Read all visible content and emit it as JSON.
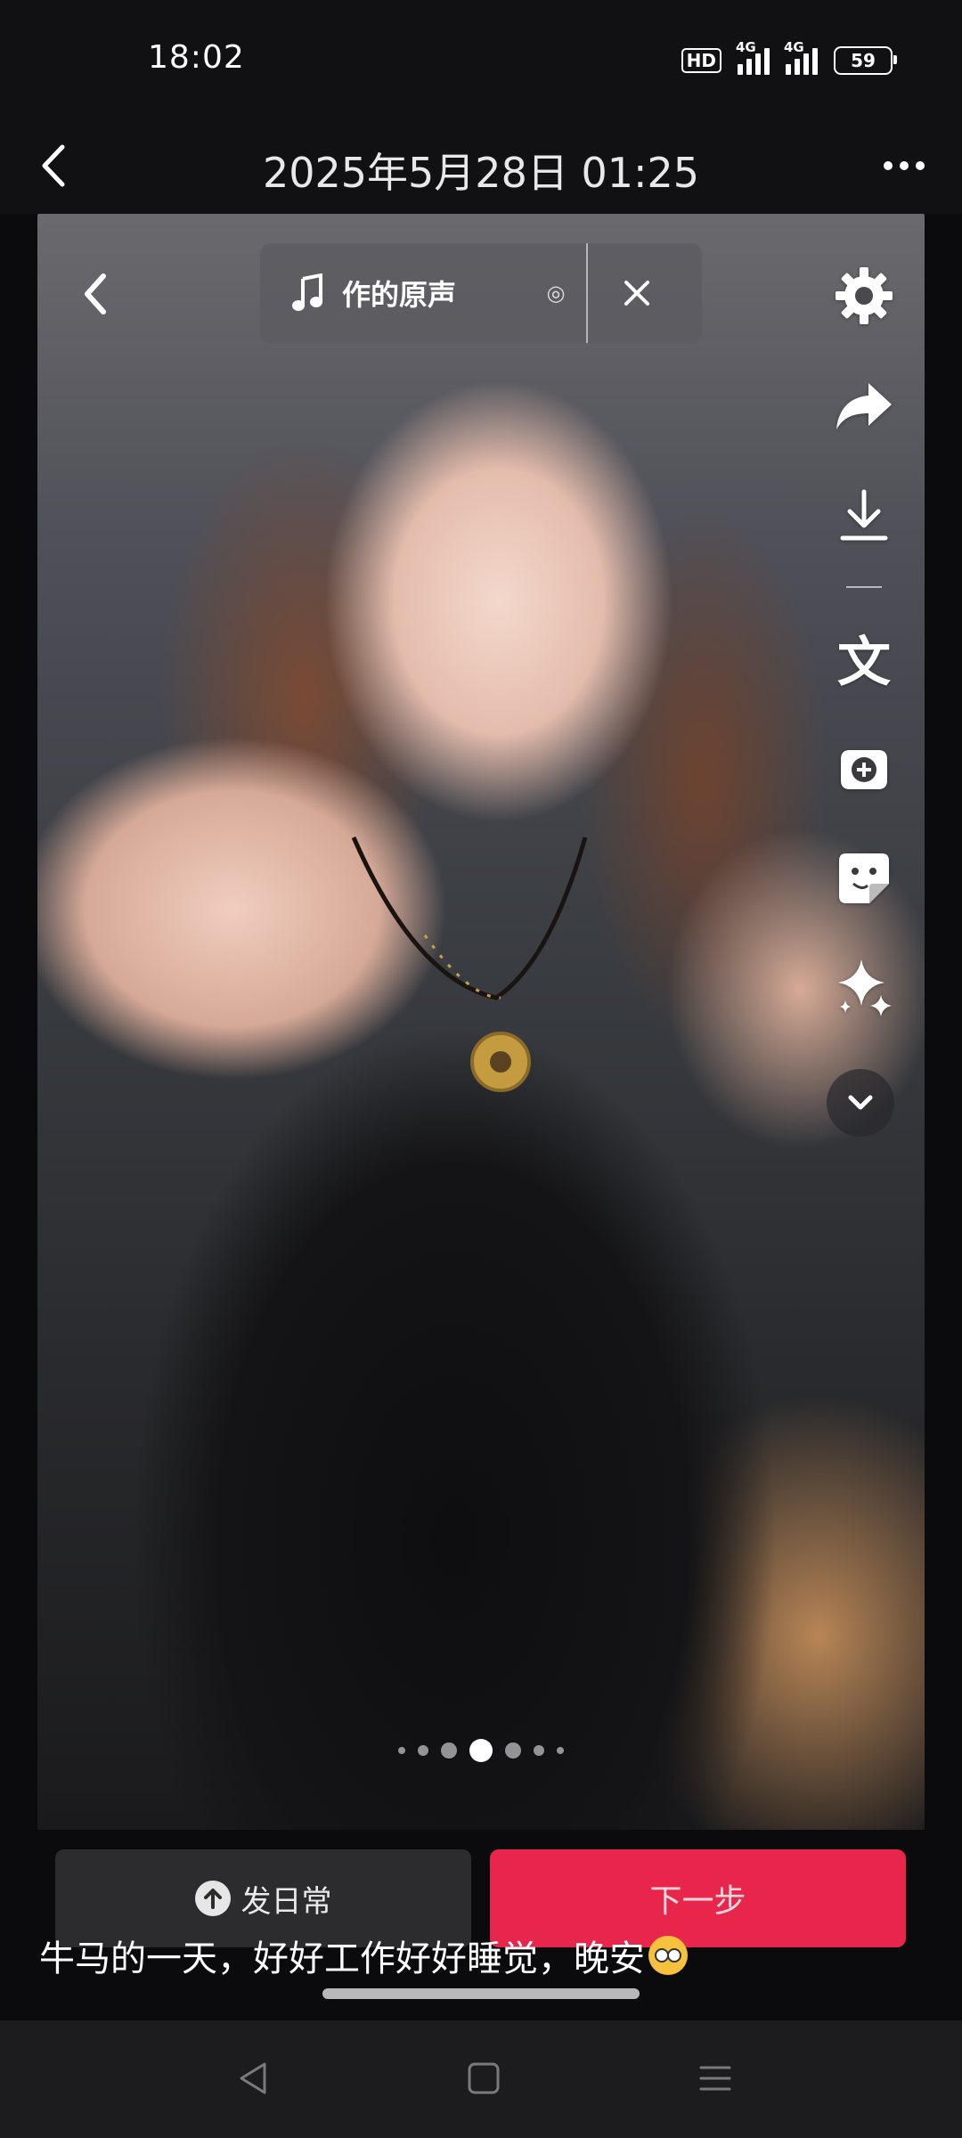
{
  "status_bar": {
    "time": "18:02",
    "hd_badge": "HD",
    "network_1": "4G",
    "network_2": "4G",
    "battery": "59"
  },
  "header": {
    "title": "2025年5月28日 01:25",
    "back_icon": "chevron-left-icon",
    "more_icon": "more-horizontal-icon"
  },
  "media": {
    "music": {
      "label": "作的原声",
      "note_icon": "music-note-icon",
      "spin_glyph": "◎",
      "close_icon": "close-icon"
    },
    "toolbar": {
      "text_tool_label": "文",
      "icons": [
        "settings-icon",
        "share-icon",
        "download-icon",
        "text-icon",
        "add-sticker-icon",
        "sticker-icon",
        "sparkle-effects-icon",
        "chevron-down-icon"
      ]
    },
    "pager": {
      "count": 7,
      "active_index": 3
    }
  },
  "actions": {
    "daily_label": "发日常",
    "next_label": "下一步",
    "daily_color": "#2c2c2e",
    "next_color": "#e8264b"
  },
  "caption": {
    "text": "牛马的一天，好好工作好好睡觉，晚安"
  },
  "nav": {
    "icons": [
      "nav-back-icon",
      "nav-home-icon",
      "nav-menu-icon"
    ]
  }
}
